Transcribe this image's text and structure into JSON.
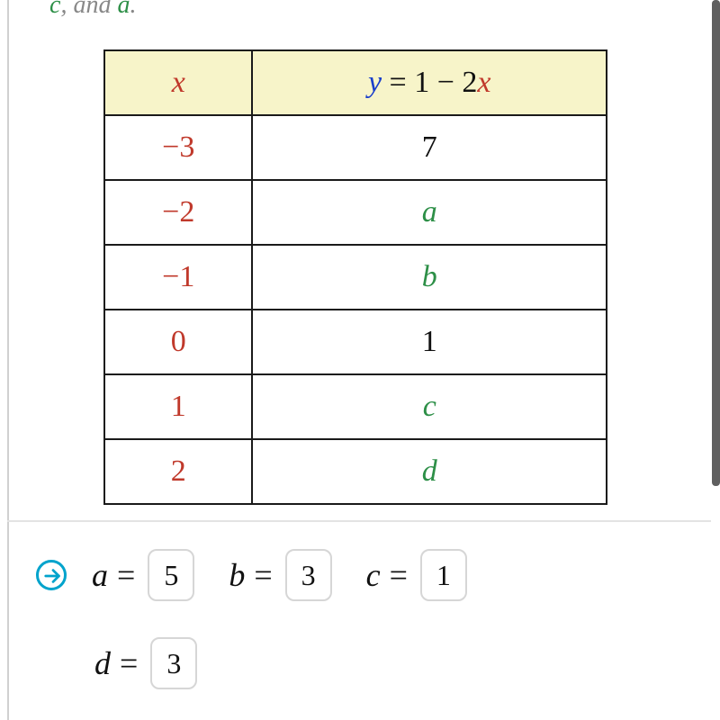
{
  "top_fragment": {
    "c": "c",
    "and": ", and ",
    "a": "a",
    "period": "."
  },
  "table": {
    "headers": {
      "x": "x",
      "y_prefix": "y",
      "eq": " = 1 − 2",
      "x_suffix": "x"
    },
    "rows": [
      {
        "x": "−3",
        "y": "7",
        "y_is_var": false
      },
      {
        "x": "−2",
        "y": "a",
        "y_is_var": true
      },
      {
        "x": "−1",
        "y": "b",
        "y_is_var": true
      },
      {
        "x": "0",
        "y": "1",
        "y_is_var": false
      },
      {
        "x": "1",
        "y": "c",
        "y_is_var": true
      },
      {
        "x": "2",
        "y": "d",
        "y_is_var": true
      }
    ]
  },
  "answers": {
    "a": {
      "label": "a",
      "eq": "=",
      "value": "5"
    },
    "b": {
      "label": "b",
      "eq": "=",
      "value": "3"
    },
    "c": {
      "label": "c",
      "eq": "=",
      "value": "1"
    },
    "d": {
      "label": "d",
      "eq": "=",
      "value": "3"
    }
  }
}
